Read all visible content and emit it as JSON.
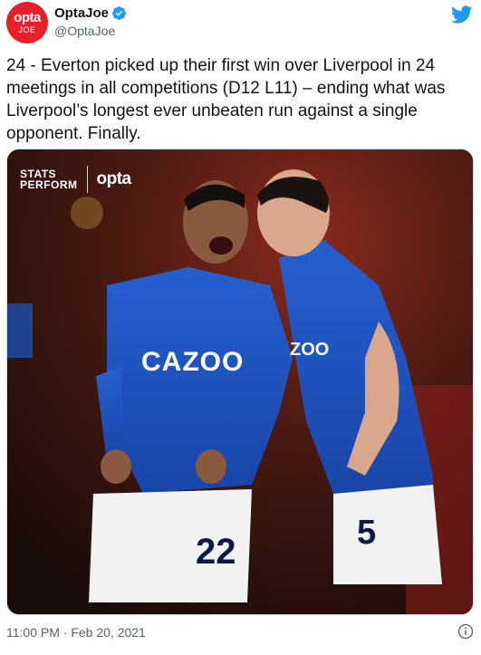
{
  "tweet": {
    "avatar": {
      "line1": "opta",
      "line2": "JOE"
    },
    "display_name": "OptaJoe",
    "handle": "@OptaJoe",
    "text": "24 - Everton picked up their first win over Liverpool in 24 meetings in all competitions (D12 L11) – ending what was Liverpool’s longest ever unbeaten run against a single opponent. Finally.",
    "timestamp": "11:00 PM · Feb 20, 2021",
    "icons": [
      "verified-badge-icon",
      "twitter-bird-icon",
      "info-icon"
    ],
    "colors": {
      "verified": "#1d9bf0",
      "twitter": "#1d9bf0",
      "avatar": "#e8202a",
      "kit": "#1b4fb8"
    }
  },
  "media": {
    "brand": {
      "stats": "STATS",
      "perform": "PERFORM",
      "opta": "opta"
    },
    "sponsor": "CAZOO",
    "sponsor_partial": "ZOO",
    "shirt_numbers": [
      "22",
      "5"
    ]
  }
}
